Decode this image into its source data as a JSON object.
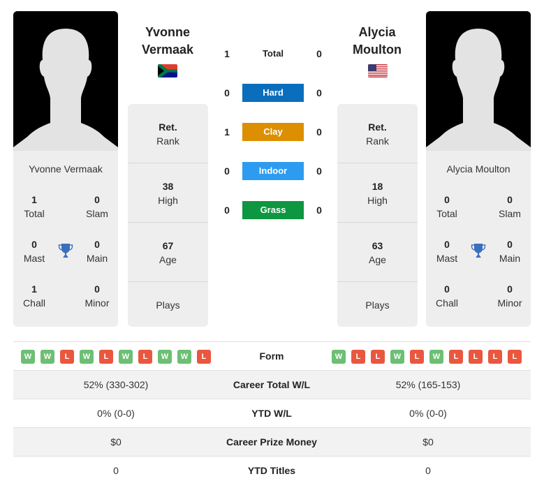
{
  "player1": {
    "name": "Yvonne Vermaak",
    "name_line1": "Yvonne",
    "name_line2": "Vermaak",
    "flag": "south-africa-flag",
    "titles": {
      "total": {
        "value": "1",
        "label": "Total"
      },
      "slam": {
        "value": "0",
        "label": "Slam"
      },
      "mast": {
        "value": "0",
        "label": "Mast"
      },
      "main": {
        "value": "0",
        "label": "Main"
      },
      "chall": {
        "value": "1",
        "label": "Chall"
      },
      "minor": {
        "value": "0",
        "label": "Minor"
      }
    },
    "rank": {
      "value": "Ret.",
      "label": "Rank"
    },
    "high": {
      "value": "38",
      "label": "High"
    },
    "age": {
      "value": "67",
      "label": "Age"
    },
    "plays": {
      "value": "",
      "label": "Plays"
    },
    "form": [
      "W",
      "W",
      "L",
      "W",
      "L",
      "W",
      "L",
      "W",
      "W",
      "L"
    ]
  },
  "player2": {
    "name": "Alycia Moulton",
    "name_line1": "Alycia",
    "name_line2": "Moulton",
    "flag": "usa-flag",
    "titles": {
      "total": {
        "value": "0",
        "label": "Total"
      },
      "slam": {
        "value": "0",
        "label": "Slam"
      },
      "mast": {
        "value": "0",
        "label": "Mast"
      },
      "main": {
        "value": "0",
        "label": "Main"
      },
      "chall": {
        "value": "0",
        "label": "Chall"
      },
      "minor": {
        "value": "0",
        "label": "Minor"
      }
    },
    "rank": {
      "value": "Ret.",
      "label": "Rank"
    },
    "high": {
      "value": "18",
      "label": "High"
    },
    "age": {
      "value": "63",
      "label": "Age"
    },
    "plays": {
      "value": "",
      "label": "Plays"
    },
    "form": [
      "W",
      "L",
      "L",
      "W",
      "L",
      "W",
      "L",
      "L",
      "L",
      "L"
    ]
  },
  "h2h": [
    {
      "label": "Total",
      "p1": "1",
      "p2": "0",
      "color": ""
    },
    {
      "label": "Hard",
      "p1": "0",
      "p2": "0",
      "color": "#0a6ebd"
    },
    {
      "label": "Clay",
      "p1": "1",
      "p2": "0",
      "color": "#dc8f00"
    },
    {
      "label": "Indoor",
      "p1": "0",
      "p2": "0",
      "color": "#2d9cf0"
    },
    {
      "label": "Grass",
      "p1": "0",
      "p2": "0",
      "color": "#0e9640"
    }
  ],
  "form_label": "Form",
  "stats": [
    {
      "label": "Career Total W/L",
      "p1": "52% (330-302)",
      "p2": "52% (165-153)"
    },
    {
      "label": "YTD W/L",
      "p1": "0% (0-0)",
      "p2": "0% (0-0)"
    },
    {
      "label": "Career Prize Money",
      "p1": "$0",
      "p2": "$0"
    },
    {
      "label": "YTD Titles",
      "p1": "0",
      "p2": "0"
    }
  ],
  "colors": {
    "win": "#6cbf73",
    "loss": "#e9573f",
    "trophy": "#3a6fbf",
    "card_bg": "#eeeeee"
  }
}
